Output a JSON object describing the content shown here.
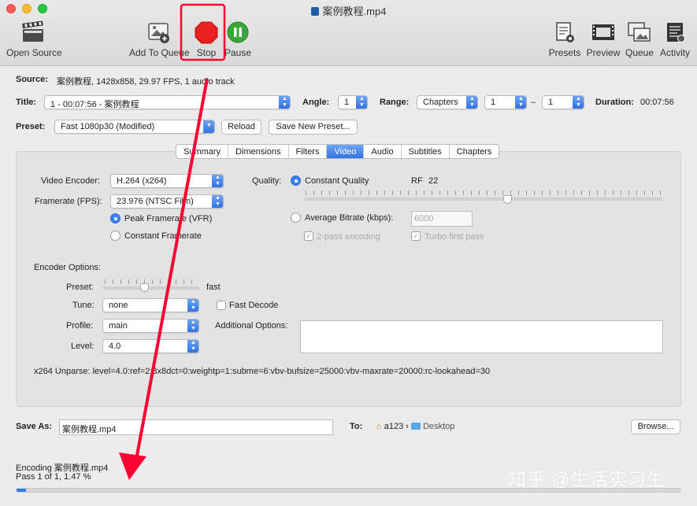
{
  "window": {
    "title": "案例教程.mp4"
  },
  "toolbar": {
    "open_source": "Open Source",
    "add_to_queue": "Add To Queue",
    "stop": "Stop",
    "pause": "Pause",
    "presets": "Presets",
    "preview": "Preview",
    "queue": "Queue",
    "activity": "Activity"
  },
  "source": {
    "label": "Source:",
    "value": "案例教程, 1428x858, 29.97 FPS, 1 audio track"
  },
  "title_row": {
    "title_label": "Title:",
    "title_value": "1 - 00:07:56 - 案例教程",
    "angle_label": "Angle:",
    "angle_value": "1",
    "range_label": "Range:",
    "range_type": "Chapters",
    "range_from": "1",
    "range_sep": "–",
    "range_to": "1",
    "duration_label": "Duration:",
    "duration_value": "00:07:56"
  },
  "preset_row": {
    "label": "Preset:",
    "value": "Fast 1080p30 (Modified)",
    "reload": "Reload",
    "save_new": "Save New Preset..."
  },
  "tabs": [
    "Summary",
    "Dimensions",
    "Filters",
    "Video",
    "Audio",
    "Subtitles",
    "Chapters"
  ],
  "active_tab": "Video",
  "video": {
    "encoder_label": "Video Encoder:",
    "encoder_value": "H.264 (x264)",
    "framerate_label": "Framerate (FPS):",
    "framerate_value": "23.976 (NTSC Film)",
    "peak_framerate": "Peak Framerate (VFR)",
    "constant_framerate": "Constant Framerate",
    "quality_label": "Quality:",
    "constant_quality": "Constant Quality",
    "rf_label": "RF",
    "rf_value": "22",
    "average_bitrate": "Average Bitrate (kbps):",
    "bitrate_value": "6000",
    "two_pass": "2-pass encoding",
    "turbo_first_pass": "Turbo first pass"
  },
  "encoder_options": {
    "header": "Encoder Options:",
    "preset_label": "Preset:",
    "preset_value": "fast",
    "tune_label": "Tune:",
    "tune_value": "none",
    "fast_decode": "Fast Decode",
    "profile_label": "Profile:",
    "profile_value": "main",
    "additional_label": "Additional Options:",
    "additional_value": "",
    "level_label": "Level:",
    "level_value": "4.0",
    "unparse": "x264 Unparse: level=4.0:ref=2:8x8dct=0:weightp=1:subme=6:vbv-bufsize=25000:vbv-maxrate=20000:rc-lookahead=30"
  },
  "save": {
    "label": "Save As:",
    "value": "案例教程.mp4",
    "to_label": "To:",
    "path_home": "a123",
    "path_sep": "›",
    "path_folder": "Desktop",
    "browse": "Browse..."
  },
  "status": {
    "line1": "Encoding 案例教程.mp4",
    "line2": "Pass 1 of 1, 1.47 %",
    "progress_fraction": 0.0147
  },
  "watermark": "知乎 @生活实习生",
  "colors": {
    "accent": "#3b82f6",
    "annotation": "#ff0033",
    "stop": "#e8201f",
    "pause": "#3aa637"
  }
}
